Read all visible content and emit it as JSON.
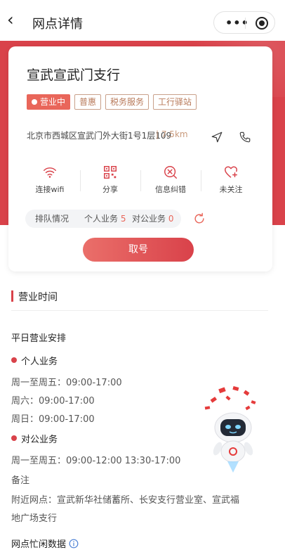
{
  "nav": {
    "back_glyph": "‹",
    "title": "网点详情",
    "more_glyph": "•••"
  },
  "branch": {
    "name": "宣武宣武门支行",
    "tags": [
      "营业中",
      "普惠",
      "税务服务",
      "工行驿站"
    ],
    "address": "北京市西城区宣武门外大街1号1层109",
    "distance": "| 7.5km"
  },
  "actions": [
    {
      "label": "连接wifi",
      "icon": "wifi-icon"
    },
    {
      "label": "分享",
      "icon": "qrcode-icon"
    },
    {
      "label": "信息纠错",
      "icon": "close-circle-icon"
    },
    {
      "label": "未关注",
      "icon": "heart-add-icon"
    }
  ],
  "queue": {
    "label": "排队情况",
    "personal_label": "个人业务",
    "personal_count": "5",
    "corporate_label": "对公业务",
    "corporate_count": "0"
  },
  "take_number_label": "取号",
  "hours": {
    "section_title": "营业时间",
    "weekday_title": "平日营业安排",
    "personal_title": "个人业务",
    "personal_lines": [
      "周一至周五：09:00-17:00",
      "周六：09:00-17:00",
      "周日：09:00-17:00"
    ],
    "corporate_title": "对公业务",
    "corporate_lines": [
      "周一至周五：09:00-12:00 13:30-17:00"
    ],
    "notes_title": "备注",
    "notes_line1": "附近网点：宣武新华社储蓄所、长安支行营业室、宣武福",
    "notes_line2": "地广场支行"
  },
  "busy_title": "网点忙闲数据",
  "colors": {
    "brand_red": "#d9424a",
    "accent_orange": "#e9665a",
    "tag_brown": "#b87a5a"
  }
}
